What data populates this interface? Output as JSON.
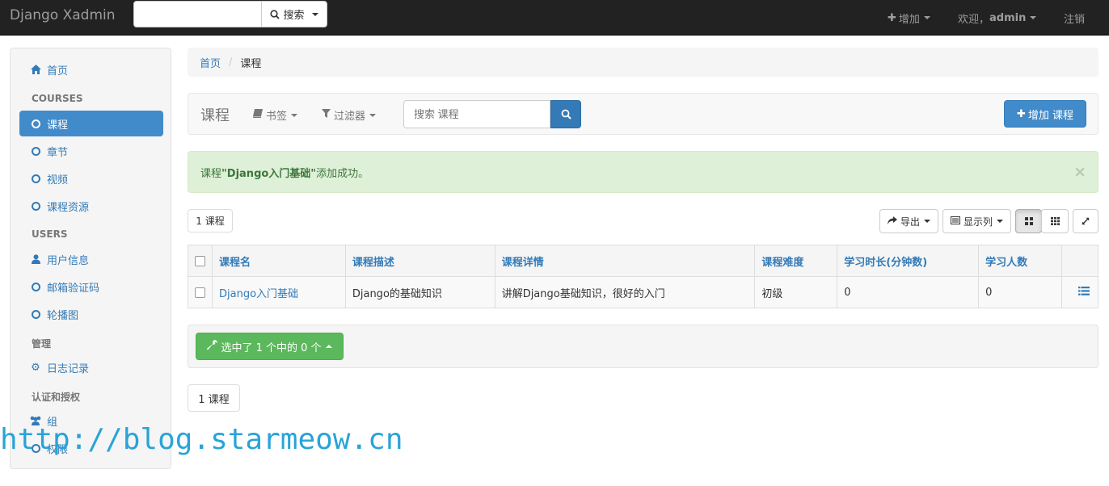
{
  "navbar": {
    "brand": "Django Xadmin",
    "search_button": "搜索",
    "add_label": "增加",
    "welcome": "欢迎，",
    "username": "admin",
    "logout": "注销"
  },
  "sidebar": {
    "home": "首页",
    "groups": [
      {
        "header": "COURSES",
        "items": [
          "课程",
          "章节",
          "视频",
          "课程资源"
        ]
      },
      {
        "header": "USERS",
        "items": [
          "用户信息",
          "邮箱验证码",
          "轮播图"
        ]
      },
      {
        "header": "管理",
        "items": [
          "日志记录"
        ]
      },
      {
        "header": "认证和授权",
        "items": [
          "组",
          "权限"
        ]
      }
    ]
  },
  "breadcrumb": {
    "home": "首页",
    "current": "课程"
  },
  "toolbar": {
    "title": "课程",
    "bookmarks": "书签",
    "filters": "过滤器",
    "search_placeholder": "搜索 课程",
    "add_button": "增加 课程"
  },
  "alert": {
    "prefix": "课程 ",
    "object": "\"Django入门基础\"",
    "suffix": " 添加成功。",
    "close": "×"
  },
  "results": {
    "count_top": "1 课程",
    "count_bottom": "1 课程",
    "export": "导出",
    "columns_button": "显示列"
  },
  "table": {
    "headers": [
      "课程名",
      "课程描述",
      "课程详情",
      "课程难度",
      "学习时长(分钟数)",
      "学习人数"
    ],
    "rows": [
      [
        "Django入门基础",
        "Django的基础知识",
        "讲解Django基础知识，很好的入门",
        "初级",
        "0",
        "0"
      ]
    ]
  },
  "actions": {
    "selected": "选中了 1 个中的 0 个"
  },
  "watermark": "http://blog.starmeow.cn",
  "colors": {
    "primary": "#428bca",
    "success": "#5cb85c",
    "navbar": "#222222",
    "alert_bg": "#dff0d8"
  }
}
